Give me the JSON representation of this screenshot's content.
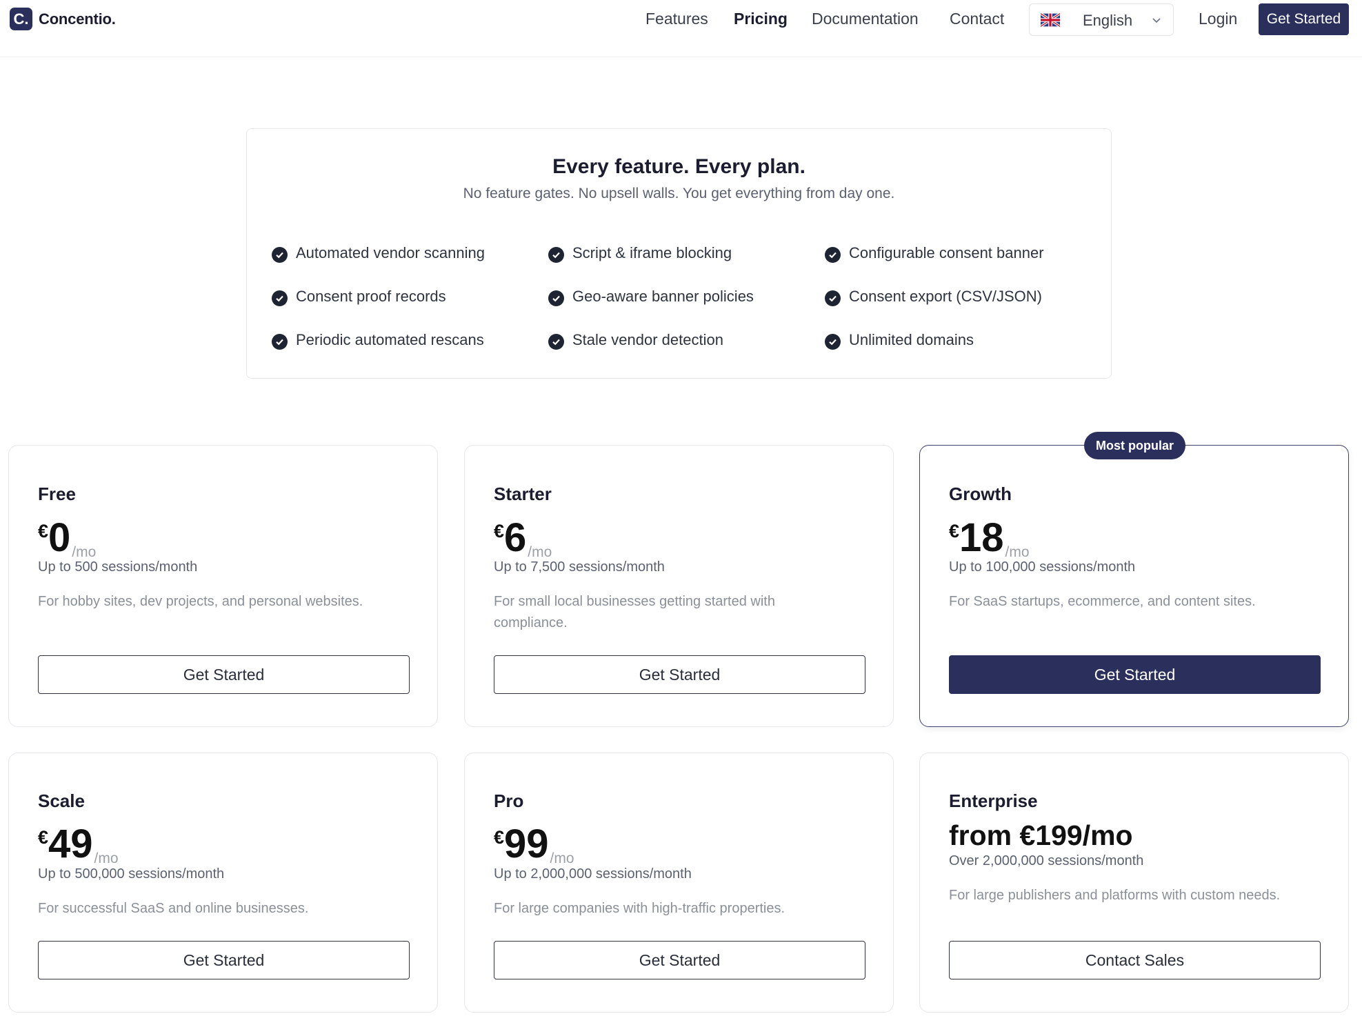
{
  "brand": {
    "logo_letter": "C.",
    "name": "Concentio."
  },
  "nav": {
    "links": [
      "Features",
      "Pricing",
      "Documentation",
      "Contact"
    ],
    "active": "Pricing",
    "language": "English",
    "login": "Login",
    "cta": "Get Started"
  },
  "features": {
    "title": "Every feature. Every plan.",
    "subtitle": "No feature gates. No upsell walls. You get everything from day one.",
    "items": [
      "Automated vendor scanning",
      "Script & iframe blocking",
      "Configurable consent banner",
      "Consent proof records",
      "Geo-aware banner policies",
      "Consent export (CSV/JSON)",
      "Periodic automated rescans",
      "Stale vendor detection",
      "Unlimited domains"
    ]
  },
  "plans": [
    {
      "name": "Free",
      "currency": "€",
      "amount": "0",
      "period": "/mo",
      "sessions": "Up to 500 sessions/month",
      "description": "For hobby sites, dev projects, and personal websites.",
      "button": "Get Started"
    },
    {
      "name": "Starter",
      "currency": "€",
      "amount": "6",
      "period": "/mo",
      "sessions": "Up to 7,500 sessions/month",
      "description": "For small local businesses getting started with compliance.",
      "button": "Get Started"
    },
    {
      "name": "Growth",
      "badge": "Most popular",
      "currency": "€",
      "amount": "18",
      "period": "/mo",
      "sessions": "Up to 100,000 sessions/month",
      "description": "For SaaS startups, ecommerce, and content sites.",
      "button": "Get Started"
    },
    {
      "name": "Scale",
      "currency": "€",
      "amount": "49",
      "period": "/mo",
      "sessions": "Up to 500,000 sessions/month",
      "description": "For successful SaaS and online businesses.",
      "button": "Get Started"
    },
    {
      "name": "Pro",
      "currency": "€",
      "amount": "99",
      "period": "/mo",
      "sessions": "Up to 2,000,000 sessions/month",
      "description": "For large companies with high-traffic properties.",
      "button": "Get Started"
    },
    {
      "name": "Enterprise",
      "price_text": "from €199/mo",
      "sessions": "Over 2,000,000 sessions/month",
      "description": "For large publishers and platforms with custom needs.",
      "button": "Contact Sales"
    }
  ],
  "icons": {
    "flag": "uk-flag-icon",
    "dropdown": "chevron-down-icon",
    "check": "check-circle-icon"
  },
  "colors": {
    "brand": "#2b2f5c",
    "text": "#1b1d2e",
    "muted": "#8a8f98"
  }
}
